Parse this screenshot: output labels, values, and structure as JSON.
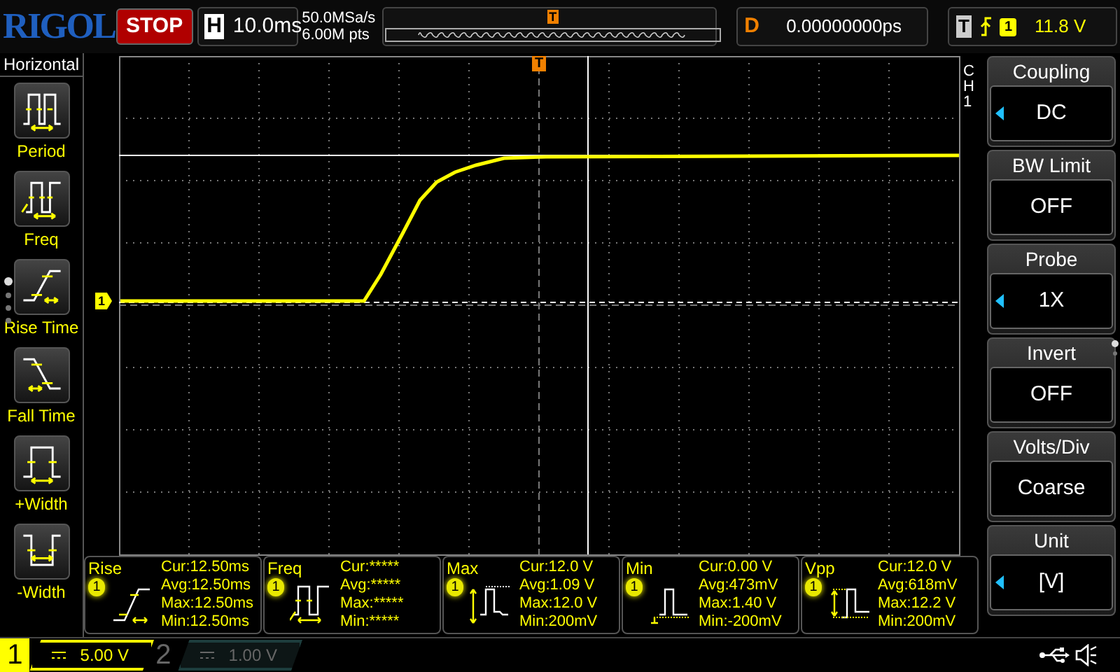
{
  "logo": "RIGOL",
  "run_button": {
    "label": "STOP"
  },
  "timebase": {
    "label": "H",
    "value": "10.0ms"
  },
  "acquisition": {
    "sample_rate": "50.0MSa/s",
    "memory_depth": "6.00M pts"
  },
  "memory_bar": {
    "marker": "T"
  },
  "delay": {
    "label": "D",
    "value": "0.00000000ps"
  },
  "trigger": {
    "label": "T",
    "source": "1",
    "level": "11.8 V"
  },
  "left_menu": {
    "title": "Horizontal",
    "page_dots": [
      {
        "selected": true
      },
      {
        "selected": false
      },
      {
        "selected": false
      },
      {
        "selected": false
      }
    ],
    "items": [
      {
        "label": "Period",
        "kind": "period"
      },
      {
        "label": "Freq",
        "kind": "freq"
      },
      {
        "label": "Rise Time",
        "kind": "rise"
      },
      {
        "label": "Fall Time",
        "kind": "fall"
      },
      {
        "label": "+Width",
        "kind": "pwidth"
      },
      {
        "label": "-Width",
        "kind": "nwidth"
      }
    ]
  },
  "display": {
    "trigger_marker": "T",
    "channel_marker": "1",
    "channel_label": "CH1"
  },
  "right_menu": {
    "page_dots": [
      {
        "selected": true
      },
      {
        "selected": false
      }
    ],
    "items": [
      {
        "title": "Coupling",
        "value": "DC",
        "adjustable": true
      },
      {
        "title": "BW Limit",
        "value": "OFF",
        "adjustable": false
      },
      {
        "title": "Probe",
        "value": "1X",
        "adjustable": true
      },
      {
        "title": "Invert",
        "value": "OFF",
        "adjustable": false
      },
      {
        "title": "Volts/Div",
        "value": "Coarse",
        "adjustable": false
      },
      {
        "title": "Unit",
        "value": "[V]",
        "adjustable": true
      }
    ]
  },
  "measurements": [
    {
      "name": "Rise",
      "source": "1",
      "kind": "rise",
      "lines": [
        "Cur:12.50ms",
        "Avg:12.50ms",
        "Max:12.50ms",
        "Min:12.50ms"
      ]
    },
    {
      "name": "Freq",
      "source": "1",
      "kind": "freq",
      "lines": [
        "Cur:*****",
        "Avg:*****",
        "Max:*****",
        "Min:*****"
      ]
    },
    {
      "name": "Max",
      "source": "1",
      "kind": "max",
      "lines": [
        "Cur:12.0 V",
        "Avg:1.09 V",
        "Max:12.0 V",
        "Min:200mV"
      ]
    },
    {
      "name": "Min",
      "source": "1",
      "kind": "min",
      "lines": [
        "Cur:0.00 V",
        "Avg:473mV",
        "Max:1.40 V",
        "Min:-200mV"
      ]
    },
    {
      "name": "Vpp",
      "source": "1",
      "kind": "vpp",
      "lines": [
        "Cur:12.0 V",
        "Avg:618mV",
        "Max:12.2 V",
        "Min:200mV"
      ]
    }
  ],
  "channels": [
    {
      "number": "1",
      "scale": "5.00 V",
      "on": true
    },
    {
      "number": "2",
      "scale": "1.00 V",
      "on": false
    }
  ]
}
